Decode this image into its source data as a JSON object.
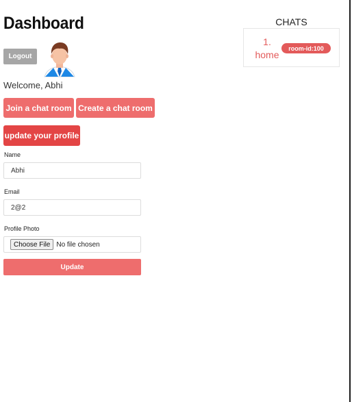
{
  "header": {
    "title": "Dashboard"
  },
  "user": {
    "logout_label": "Logout",
    "avatar_icon": "user-avatar-icon",
    "welcome_text": "Welcome, Abhi"
  },
  "actions": {
    "join_label": "Join a chat room",
    "create_label": "Create a chat room",
    "update_profile_label": "update your profile"
  },
  "profile_form": {
    "name_label": "Name",
    "name_value": "Abhi",
    "email_label": "Email",
    "email_value": "2@2",
    "photo_label": "Profile Photo",
    "choose_file_label": "Choose File",
    "no_file_text": "No file chosen",
    "update_label": "Update"
  },
  "chats": {
    "title": "CHATS",
    "rooms": [
      {
        "index": "1.",
        "name": "home",
        "badge": "room-id:100"
      }
    ]
  },
  "colors": {
    "accent": "#ee6d6d",
    "accent_dark": "#e34545",
    "link": "#e35a5a",
    "muted_button": "#a6a6a6"
  }
}
